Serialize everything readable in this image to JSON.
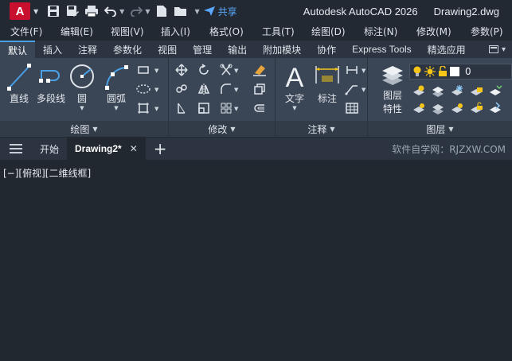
{
  "app": {
    "logo_letter": "A",
    "title": "Autodesk AutoCAD 2026",
    "filename": "Drawing2.dwg"
  },
  "qat": {
    "share_label": "共享"
  },
  "menu": [
    "文件(F)",
    "编辑(E)",
    "视图(V)",
    "插入(I)",
    "格式(O)",
    "工具(T)",
    "绘图(D)",
    "标注(N)",
    "修改(M)",
    "参数(P)"
  ],
  "ribbon_tabs": [
    "默认",
    "插入",
    "注释",
    "参数化",
    "视图",
    "管理",
    "输出",
    "附加模块",
    "协作",
    "Express Tools",
    "精选应用"
  ],
  "panels": {
    "draw": {
      "title": "绘图",
      "line": "直线",
      "polyline": "多段线",
      "circle": "圆",
      "arc": "圆弧"
    },
    "modify": {
      "title": "修改"
    },
    "annotate": {
      "title": "注释",
      "text": "文字",
      "dimension": "标注"
    },
    "layers": {
      "title": "图层",
      "layer_props_1": "图层",
      "layer_props_2": "特性",
      "current_layer": "0"
    }
  },
  "file_tabs": {
    "start": "开始",
    "drawing": "Drawing2*"
  },
  "watermark": "软件自学网：RJZXW.COM",
  "viewport_label": "[−][俯视][二维线框]",
  "colors": {
    "accent": "#4aa0e6",
    "app_red": "#c8102e",
    "share_blue": "#5aa9ff",
    "bulb_yellow": "#f5c518"
  }
}
